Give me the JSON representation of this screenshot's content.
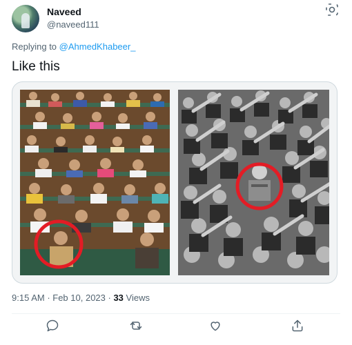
{
  "author": {
    "name": "Naveed",
    "handle": "@naveed111"
  },
  "reply": {
    "prefix": "Replying to",
    "target": "@AhmedKhabeer_"
  },
  "tweet": {
    "text": "Like this"
  },
  "media": {
    "left_image": "parliament-session-photo",
    "right_image": "black-and-white-crowd-photo",
    "highlight_color": "#e31c25"
  },
  "meta": {
    "time": "9:15 AM",
    "separator1": " · ",
    "date": "Feb 10, 2023",
    "separator2": " · ",
    "views_count": "33",
    "views_label": " Views"
  },
  "actions": {
    "reply_icon": "reply-icon",
    "retweet_icon": "retweet-icon",
    "like_icon": "like-icon",
    "share_icon": "share-icon"
  },
  "colors": {
    "link": "#1d9bf0",
    "secondary_text": "#536471",
    "primary_text": "#0f1419"
  }
}
